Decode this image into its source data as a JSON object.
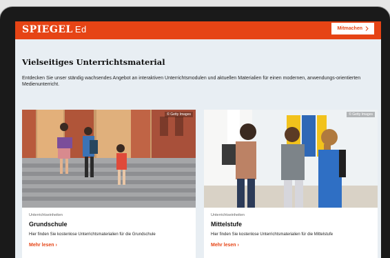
{
  "header": {
    "logo_main": "SPIEGEL",
    "logo_sub": "Ed",
    "cta_label": "Mitmachen",
    "cta_icon": "chevron-right-icon"
  },
  "section": {
    "title": "Vielseitiges Unterrichtsmaterial",
    "intro": "Entdecken Sie unser ständig wachsendes Angebot an interaktiven Unterrichtsmodulen und aktuellen Materialien für einen modernen, anwendungs-orientierten Medienunterricht."
  },
  "cards": [
    {
      "credit": "© Getty Images",
      "kicker": "Unterrichtseinheiten",
      "title": "Grundschule",
      "description": "Hier finden Sie kostenlose Unterrichtsmaterialien für die Grundschule",
      "link": "Mehr lesen ›"
    },
    {
      "credit": "© Getty Images",
      "kicker": "Unterrichtseinheiten",
      "title": "Mittelstufe",
      "description": "Hier finden Sie kostenlose Unterrichtsmaterialien für die Mittelstufe",
      "link": "Mehr lesen ›"
    }
  ],
  "colors": {
    "brand": "#e64415",
    "background": "#e8eef3"
  }
}
